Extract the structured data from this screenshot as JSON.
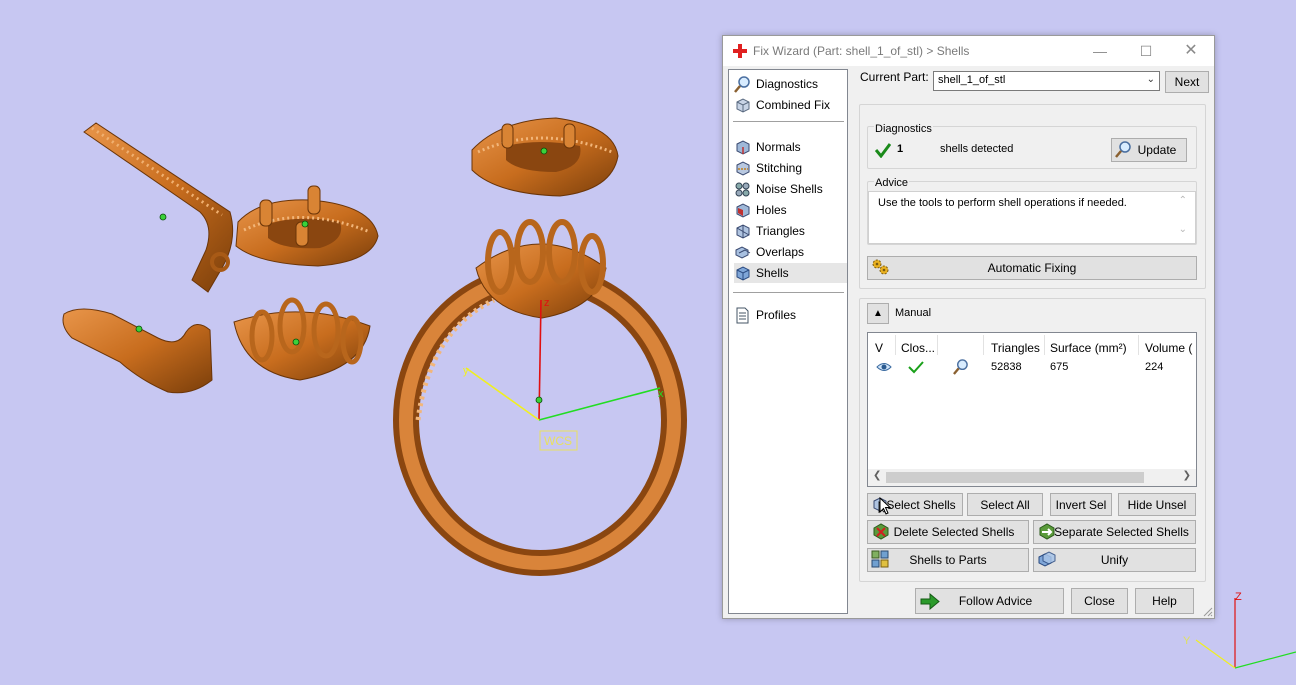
{
  "viewport": {
    "wcs_label": "WCS",
    "axes": {
      "x": "x",
      "y": "y",
      "z": "z"
    },
    "corner_axes": {
      "z": "Z",
      "y": "Y"
    }
  },
  "dialog": {
    "title": "Fix Wizard (Part: shell_1_of_stl) > Shells",
    "nav": {
      "diagnostics": "Diagnostics",
      "combined_fix": "Combined Fix",
      "items": [
        "Normals",
        "Stitching",
        "Noise Shells",
        "Holes",
        "Triangles",
        "Overlaps",
        "Shells"
      ],
      "selected": "Shells",
      "profiles": "Profiles"
    },
    "current_part_label": "Current Part:",
    "current_part_value": "shell_1_of_stl",
    "next_label": "Next",
    "diagnostics": {
      "label": "Diagnostics",
      "count": "1",
      "text": "shells detected",
      "update_label": "Update"
    },
    "advice": {
      "label": "Advice",
      "text": "Use the tools to perform shell operations if needed."
    },
    "automatic_fixing_label": "Automatic Fixing",
    "manual_label": "Manual",
    "table": {
      "headers": [
        "V",
        "Clos...",
        "",
        "Triangles",
        "Surface (mm²)",
        "Volume ("
      ],
      "rows": [
        {
          "triangles": "52838",
          "surface": "675",
          "volume": "224"
        }
      ]
    },
    "buttons": {
      "select_shells": "Select Shells",
      "select_all": "Select All",
      "invert_sel": "Invert Sel",
      "hide_unsel": "Hide Unsel",
      "delete_selected": "Delete Selected Shells",
      "separate_selected": "Separate Selected Shells",
      "shells_to_parts": "Shells to Parts",
      "unify": "Unify",
      "follow_advice": "Follow Advice",
      "close": "Close",
      "help": "Help"
    }
  }
}
